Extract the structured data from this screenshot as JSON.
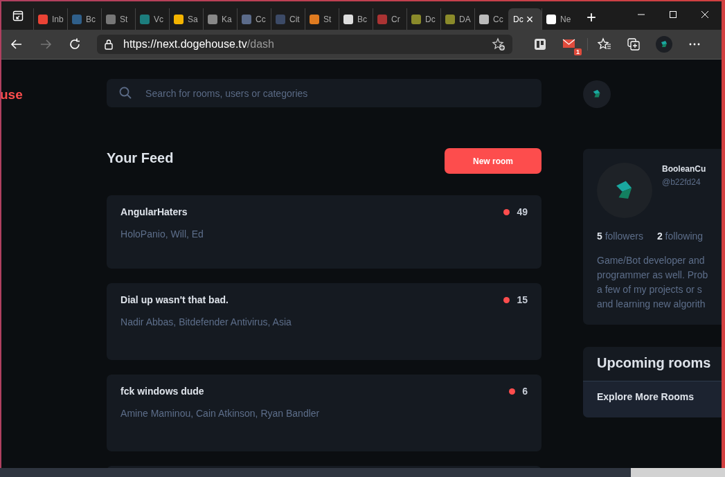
{
  "browser": {
    "tabs": [
      {
        "label": "Inb",
        "selected": false
      },
      {
        "label": "Bc",
        "selected": false
      },
      {
        "label": "St",
        "selected": false
      },
      {
        "label": "Vc",
        "selected": false
      },
      {
        "label": "Sa",
        "selected": false
      },
      {
        "label": "Ka",
        "selected": false
      },
      {
        "label": "Cc",
        "selected": false
      },
      {
        "label": "Cit",
        "selected": false
      },
      {
        "label": "St",
        "selected": false
      },
      {
        "label": "Bc",
        "selected": false
      },
      {
        "label": "Cr",
        "selected": false
      },
      {
        "label": "Dc",
        "selected": false
      },
      {
        "label": "DA",
        "selected": false
      },
      {
        "label": "Cc",
        "selected": false
      },
      {
        "label": "Dc",
        "selected": true
      },
      {
        "label": "Ne",
        "selected": false
      }
    ],
    "close_tab": "×",
    "new_tab": "+",
    "url_host": "https://next.dogehouse.tv",
    "url_path": "/dash",
    "mail_badge": "1"
  },
  "logo": "use",
  "search": {
    "placeholder": "Search for rooms, users or categories"
  },
  "feed": {
    "title": "Your Feed",
    "new_room": "New room",
    "rooms": [
      {
        "title": "AngularHaters",
        "members": "HoloPanio, Will, Ed",
        "count": "49"
      },
      {
        "title": "Dial up wasn't that bad.",
        "members": "Nadir Abbas, Bitdefender Antivirus, Asia",
        "count": "15"
      },
      {
        "title": "fck windows dude",
        "members": "Amine Maminou, Cain Atkinson, Ryan Bandler",
        "count": "6"
      }
    ]
  },
  "profile": {
    "name": "BooleanCu",
    "handle": "@b22fd24",
    "followers_count": "5",
    "followers_label": "followers",
    "following_count": "2",
    "following_label": "following",
    "bio": [
      "Game/Bot developer and",
      "programmer as well. Prob",
      "a few of my projects or s",
      "and learning new algorith"
    ]
  },
  "upcoming": {
    "title": "Upcoming rooms",
    "explore": "Explore More Rooms"
  }
}
